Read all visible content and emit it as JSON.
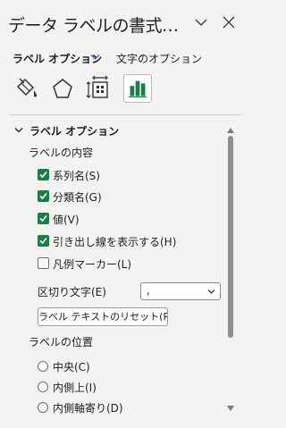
{
  "pane": {
    "title": "データ ラベルの書式…"
  },
  "tabs": {
    "label_options": "ラベル オプション",
    "text_options": "文字のオプション"
  },
  "icons": [
    "fill-line-icon",
    "effects-icon",
    "size-properties-icon",
    "label-options-chart-icon"
  ],
  "section": {
    "title": "ラベル オプション",
    "content_label": "ラベルの内容",
    "checkboxes": [
      {
        "label": "系列名(S)",
        "checked": true
      },
      {
        "label": "分類名(G)",
        "checked": true
      },
      {
        "label": "値(V)",
        "checked": true
      },
      {
        "label": "引き出し線を表示する(H)",
        "checked": true
      },
      {
        "label": "凡例マーカー(L)",
        "checked": false
      }
    ],
    "separator": {
      "label": "区切り文字(E)",
      "value": ","
    },
    "reset_button": "ラベル テキストのリセット(R)",
    "position_label": "ラベルの位置",
    "positions": [
      {
        "label": "中央(C)",
        "selected": false
      },
      {
        "label": "内側上(I)",
        "selected": false
      },
      {
        "label": "内側軸寄り(D)",
        "selected": false
      }
    ]
  },
  "colors": {
    "checkbox_checked": "#1e7b47",
    "accent_chevron": "#2f6fb3",
    "chart_icon": "#1e7b47",
    "background": "#f3f3f3"
  }
}
